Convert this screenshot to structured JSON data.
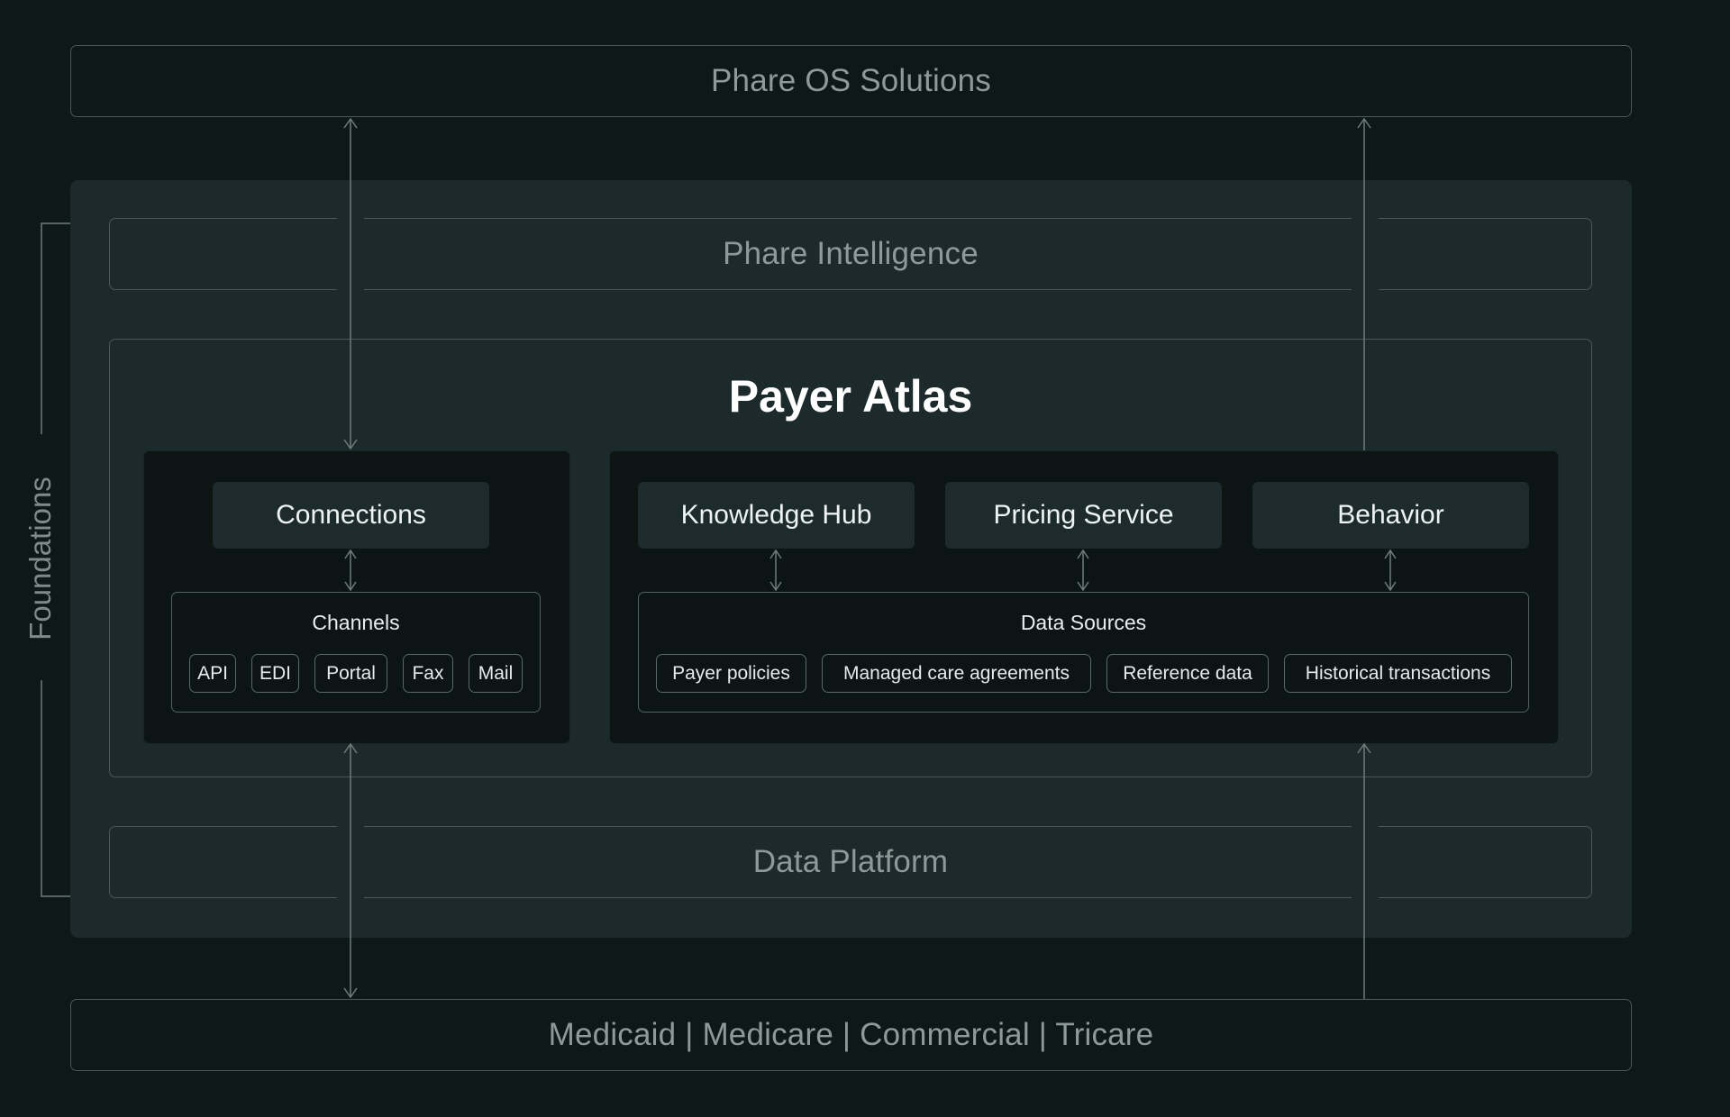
{
  "top_bar": {
    "label": "Phare OS Solutions"
  },
  "intelligence": {
    "label": "Phare Intelligence"
  },
  "atlas": {
    "title": "Payer Atlas"
  },
  "connections": {
    "label": "Connections",
    "group_label": "Channels",
    "chips": [
      "API",
      "EDI",
      "Portal",
      "Fax",
      "Mail"
    ]
  },
  "services": [
    "Knowledge Hub",
    "Pricing Service",
    "Behavior"
  ],
  "data_sources": {
    "label": "Data Sources",
    "chips": [
      "Payer policies",
      "Managed care agreements",
      "Reference data",
      "Historical transactions"
    ]
  },
  "data_platform": {
    "label": "Data Platform"
  },
  "bottom_bar": {
    "label": "Medicaid | Medicare | Commercial | Tricare"
  },
  "side_label": "Foundations",
  "colors": {
    "background": "#0e1818",
    "panel": "#1d2a2b",
    "inner_panel": "#0c1414",
    "service": "#1e2b2c",
    "line": "#6f7c7c"
  }
}
